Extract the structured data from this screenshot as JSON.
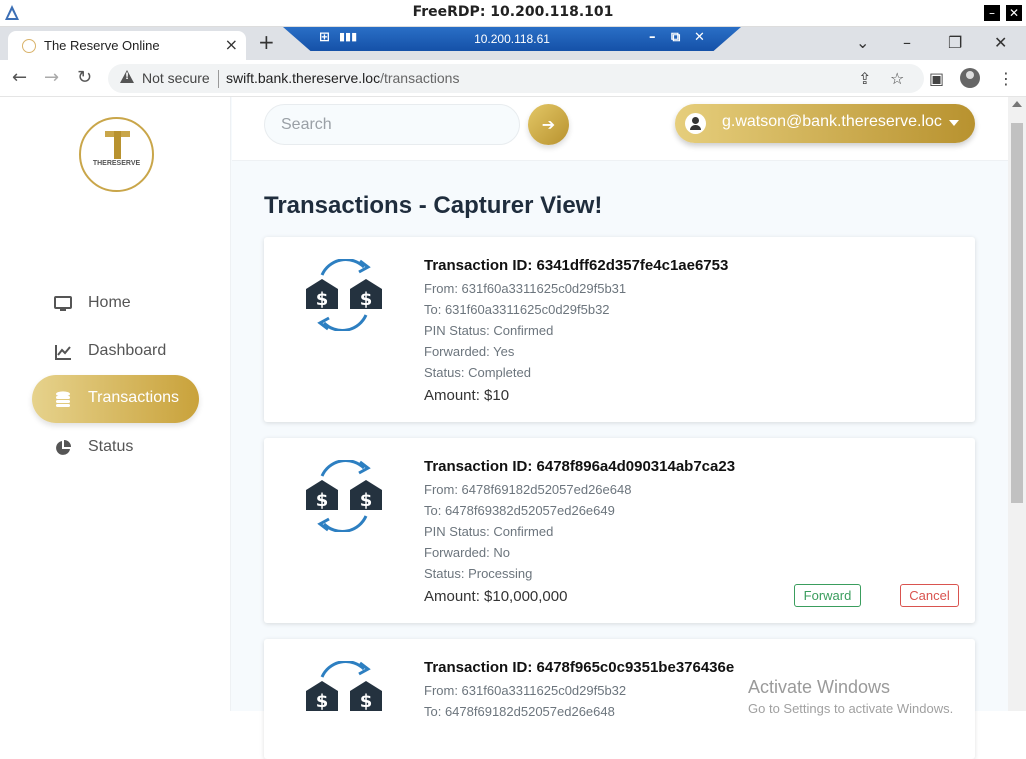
{
  "rdp": {
    "title": "FreeRDP: 10.200.118.101",
    "float_ip": "10.200.118.61"
  },
  "browser": {
    "tab_title": "The Reserve Online",
    "security_label": "Not secure",
    "url_host": "swift.bank.thereserve.loc",
    "url_path": "/transactions"
  },
  "sidebar": {
    "logo_text": "THERESERVE",
    "items": [
      {
        "label": "Home",
        "icon": "monitor-icon",
        "active": false
      },
      {
        "label": "Dashboard",
        "icon": "chart-line-icon",
        "active": false
      },
      {
        "label": "Transactions",
        "icon": "coins-icon",
        "active": true
      },
      {
        "label": "Status",
        "icon": "pie-chart-icon",
        "active": false
      }
    ]
  },
  "topbar": {
    "search_placeholder": "Search",
    "user_email": "g.watson@bank.thereserve.loc"
  },
  "main": {
    "heading": "Transactions - Capturer View!"
  },
  "transactions": [
    {
      "id": "Transaction ID: 6341dff62d357fe4c1ae6753",
      "from": "From: 631f60a3311625c0d29f5b31",
      "to": "To: 631f60a3311625c0d29f5b32",
      "pin": "PIN Status: Confirmed",
      "forwarded": "Forwarded: Yes",
      "status": "Status: Completed",
      "amount": "Amount: $10"
    },
    {
      "id": "Transaction ID: 6478f896a4d090314ab7ca23",
      "from": "From: 6478f69182d52057ed26e648",
      "to": "To: 6478f69382d52057ed26e649",
      "pin": "PIN Status: Confirmed",
      "forwarded": "Forwarded: No",
      "status": "Status: Processing",
      "amount": "Amount: $10,000,000",
      "forward_label": "Forward",
      "cancel_label": "Cancel"
    },
    {
      "id": "Transaction ID: 6478f965c0c9351be376436e",
      "from": "From: 631f60a3311625c0d29f5b32",
      "to": "To: 6478f69182d52057ed26e648"
    }
  ],
  "watermark": {
    "title": "Activate Windows",
    "subtitle": "Go to Settings to activate Windows."
  },
  "colors": {
    "gold": "#c9a23b",
    "forward": "#3a9d5d",
    "cancel": "#d9534f",
    "icon_blue": "#2d7fc1",
    "icon_dark": "#24323f"
  }
}
